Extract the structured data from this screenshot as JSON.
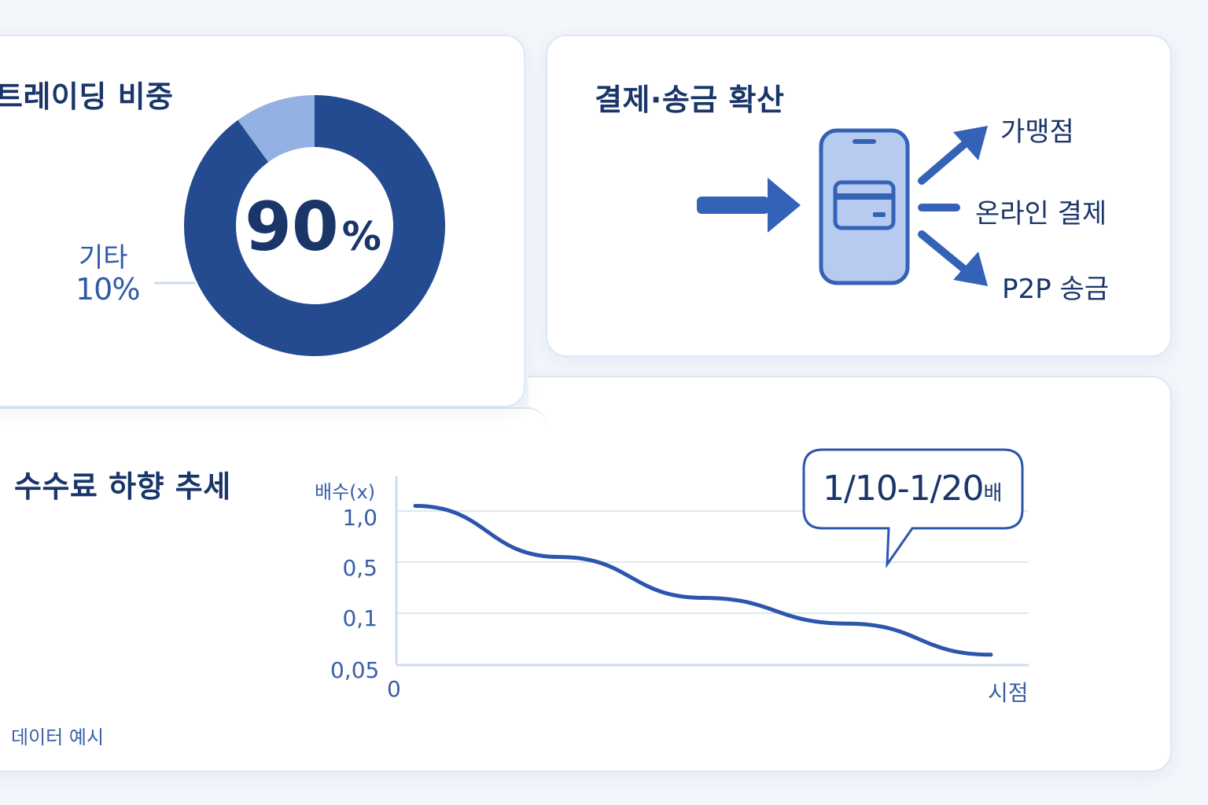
{
  "colors": {
    "navy": "#244a8f",
    "light_blue": "#93b1e2",
    "accent": "#3462b7",
    "phone_fill": "#b7caef",
    "text_dark": "#1a3669"
  },
  "share_card": {
    "title": "트레이딩 비중",
    "center_label": {
      "number": "90",
      "unit": "%"
    },
    "other_label": "기타",
    "other_value": "10%"
  },
  "payments_card": {
    "title": "결제·송금 확산",
    "icon": "smartphone-card-icon",
    "destinations": [
      "가맹점",
      "온라인 결제",
      "P2P 송금"
    ]
  },
  "fees_card": {
    "title": "수수료 하향 추세",
    "callout": {
      "main": "1/10-1/20",
      "unit": "배"
    },
    "footnote": "데이터 예시"
  },
  "chart_data": [
    {
      "type": "pie",
      "donut": true,
      "title": "트레이딩 비중",
      "slices": [
        {
          "label": "",
          "value": 90,
          "color": "#244a8f"
        },
        {
          "label": "기타",
          "value": 10,
          "color": "#93b1e2"
        }
      ]
    },
    {
      "type": "line",
      "title": "수수료 하향 추세",
      "ylabel": "배수(x)",
      "xlabel": "시점",
      "x_ticks": [
        "0"
      ],
      "y_ticks": [
        "1,0",
        "0,5",
        "0,1",
        "0,05"
      ],
      "y_tick_values": [
        1.0,
        0.5,
        0.1,
        0.05
      ],
      "series": [
        {
          "x": [
            0,
            0.25,
            0.5,
            0.75,
            1.0
          ],
          "y": [
            1.05,
            0.55,
            0.22,
            0.09,
            0.06
          ],
          "color": "#2c56ad"
        }
      ],
      "grid": true,
      "annotation": "1/10-1/20배"
    }
  ]
}
